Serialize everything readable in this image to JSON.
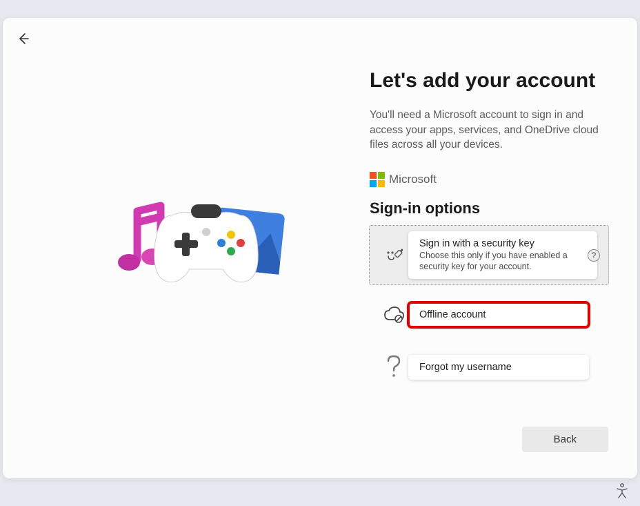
{
  "header": {
    "title": "Let's add your account",
    "subtitle": "You'll need a Microsoft account to sign in and access your apps, services, and OneDrive cloud files across all your devices."
  },
  "brand": {
    "name": "Microsoft"
  },
  "signin": {
    "section_title": "Sign-in options",
    "options": [
      {
        "icon": "usb-key-icon",
        "label": "Sign in with a security key",
        "sub": "Choose this only if you have enabled a security key for your account.",
        "selected": true,
        "help_tooltip": "?"
      },
      {
        "icon": "cloud-off-icon",
        "label": "Offline account",
        "highlighted": true
      },
      {
        "icon": "question-icon",
        "label": "Forgot my username"
      }
    ]
  },
  "footer": {
    "back_label": "Back"
  }
}
